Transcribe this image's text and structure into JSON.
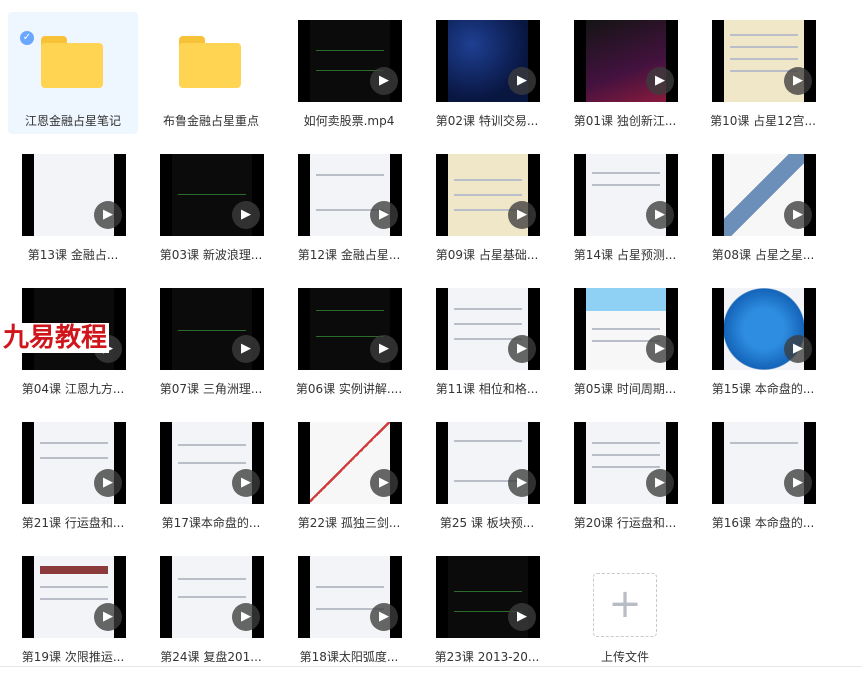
{
  "items": [
    {
      "type": "folder",
      "label": "江恩金融占星笔记",
      "selected": true
    },
    {
      "type": "folder",
      "label": "布鲁金融占星重点"
    },
    {
      "type": "video",
      "label": "如何卖股票.mp4"
    },
    {
      "type": "video",
      "label": "第02课 特训交易..."
    },
    {
      "type": "video",
      "label": "第01课 独创新江..."
    },
    {
      "type": "video",
      "label": "第10课 占星12宫..."
    },
    {
      "type": "video",
      "label": "第13课  金融占..."
    },
    {
      "type": "video",
      "label": "第03课 新波浪理..."
    },
    {
      "type": "video",
      "label": "第12课 金融占星..."
    },
    {
      "type": "video",
      "label": "第09课 占星基础..."
    },
    {
      "type": "video",
      "label": "第14课 占星预测..."
    },
    {
      "type": "video",
      "label": "第08课 占星之星..."
    },
    {
      "type": "video",
      "label": "第04课 江恩九方...",
      "overlay": "九易教程"
    },
    {
      "type": "video",
      "label": "第07课  三角洲理..."
    },
    {
      "type": "video",
      "label": "第06课 实例讲解...."
    },
    {
      "type": "video",
      "label": "第11课 相位和格..."
    },
    {
      "type": "video",
      "label": "第05课 时间周期..."
    },
    {
      "type": "video",
      "label": "第15课 本命盘的..."
    },
    {
      "type": "video",
      "label": "第21课 行运盘和..."
    },
    {
      "type": "video",
      "label": "第17课本命盘的..."
    },
    {
      "type": "video",
      "label": "第22课 孤独三剑..."
    },
    {
      "type": "video",
      "label": "第25 课 板块预..."
    },
    {
      "type": "video",
      "label": "第20课 行运盘和..."
    },
    {
      "type": "video",
      "label": "第16课 本命盘的..."
    },
    {
      "type": "video",
      "label": "第19课 次限推运..."
    },
    {
      "type": "video",
      "label": "第24课  复盘201..."
    },
    {
      "type": "video",
      "label": "第18课太阳弧度..."
    },
    {
      "type": "video",
      "label": "第23课 2013-20..."
    },
    {
      "type": "upload",
      "label": "上传文件",
      "icon": "plus-icon"
    }
  ],
  "icons": {
    "play": "play-icon",
    "check": "check-icon",
    "folder": "folder-icon"
  },
  "colors": {
    "folder": "#ffd452",
    "selection": "#eef6ff",
    "overlay_text": "#d0161b"
  }
}
